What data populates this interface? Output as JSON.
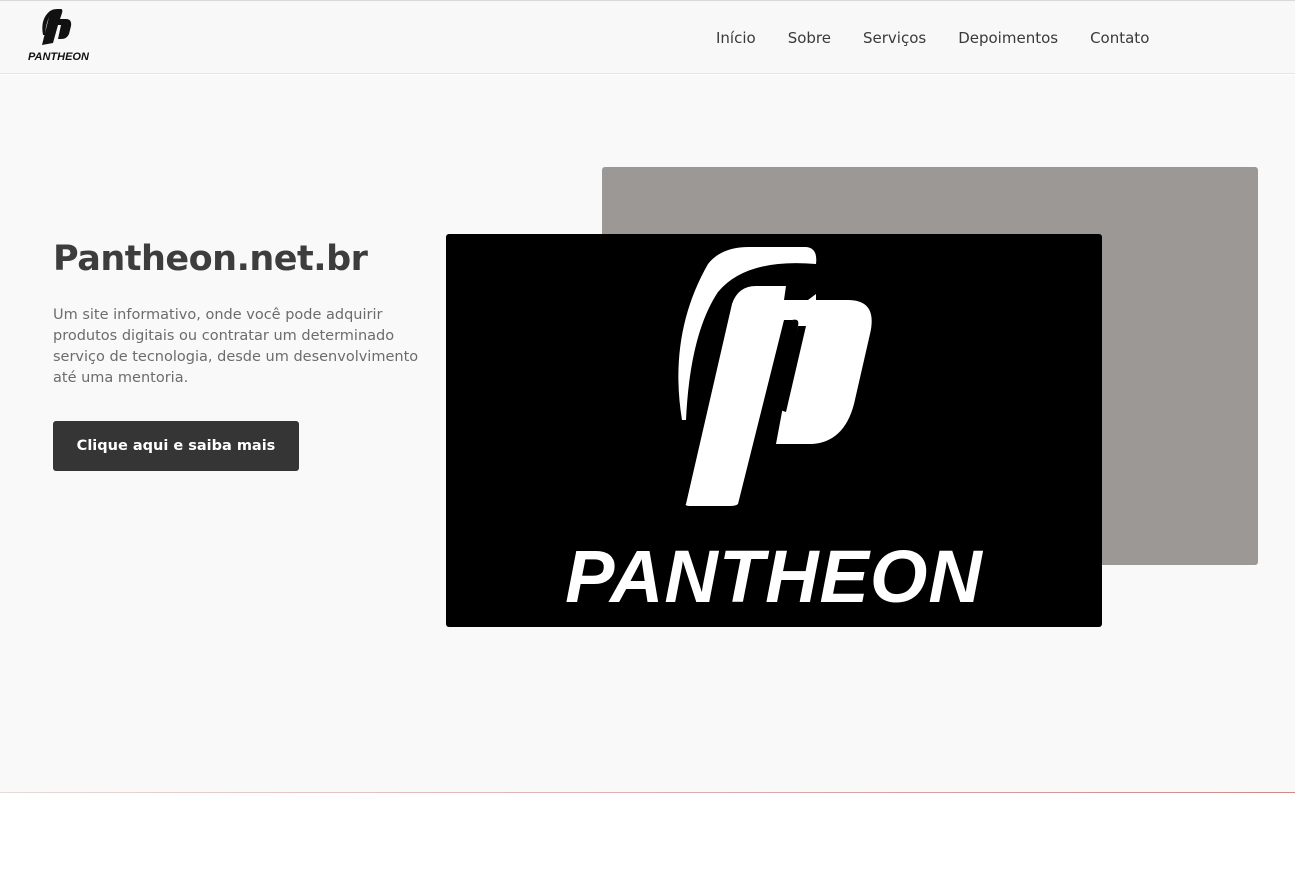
{
  "header": {
    "logo_text": "PANTHEON",
    "nav": [
      "Início",
      "Sobre",
      "Serviços",
      "Depoimentos",
      "Contato"
    ]
  },
  "hero": {
    "title": "Pantheon.net.br",
    "description": "Um site informativo, onde você pode adquirir produtos digitais ou contratar um determinado serviço de tecnologia, desde um desenvolvimento até uma mentoria.",
    "cta_label": "Clique aqui e saiba mais",
    "image_wordmark": "PANTHEON"
  },
  "colors": {
    "header_bg": "#f8f8f8",
    "hero_bg": "#f9f9f9",
    "button_bg": "#353535",
    "back_panel": "#9c9896",
    "image_bg": "#000000"
  },
  "icons": {
    "logo": "pantheon-p-logo-icon",
    "image_logo": "pantheon-p-logo-icon"
  }
}
